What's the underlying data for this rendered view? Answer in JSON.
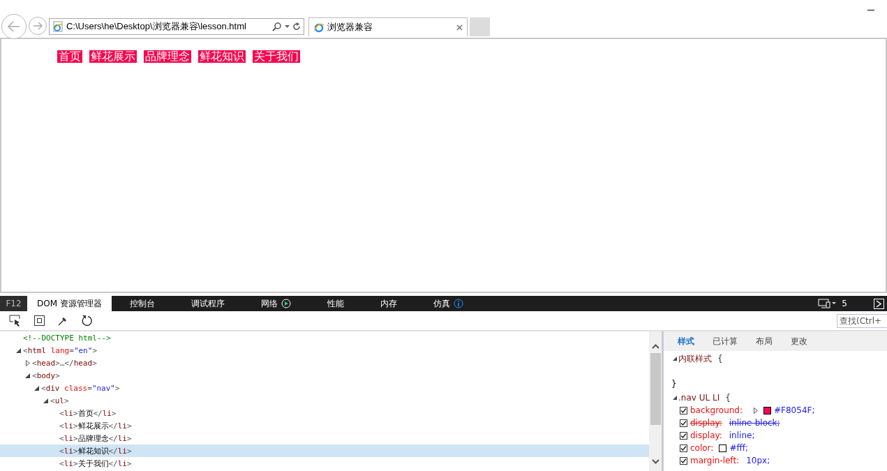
{
  "browser": {
    "address": "C:\\Users\\he\\Desktop\\浏览器兼容\\lesson.html",
    "tab_title": "浏览器兼容"
  },
  "page": {
    "nav_items": [
      "首页",
      "鲜花展示",
      "品牌理念",
      "鲜花知识",
      "关于我们"
    ]
  },
  "devtools": {
    "f12_label": "F12",
    "tabs": [
      {
        "label": "DOM 资源管理器",
        "selected": true,
        "kind": "plain"
      },
      {
        "label": "控制台",
        "selected": false,
        "kind": "plain"
      },
      {
        "label": "调试程序",
        "selected": false,
        "kind": "plain"
      },
      {
        "label": "网络",
        "selected": false,
        "kind": "play"
      },
      {
        "label": "性能",
        "selected": false,
        "kind": "plain"
      },
      {
        "label": "内存",
        "selected": false,
        "kind": "plain"
      },
      {
        "label": "仿真",
        "selected": false,
        "kind": "info"
      }
    ],
    "emulation_count": "5",
    "search": {
      "placeholder": "查找(Ctrl+"
    },
    "dom_tree": [
      {
        "tokens": [
          {
            "t": "<!--DOCTYPE html-->",
            "kind": "comment"
          }
        ],
        "selected": false
      },
      {
        "tokens": [
          {
            "t": "<",
            "kind": "punct"
          },
          {
            "t": "html",
            "kind": "tag"
          },
          {
            "t": " lang",
            "kind": "attr"
          },
          {
            "t": "=",
            "kind": "punct"
          },
          {
            "t": "\"en\"",
            "kind": "value"
          },
          {
            "t": ">",
            "kind": "punct"
          }
        ],
        "expanded": true,
        "selected": false,
        "children": [
          {
            "tokens": [
              {
                "t": "<",
                "kind": "punct"
              },
              {
                "t": "head",
                "kind": "tag"
              },
              {
                "t": ">…</",
                "kind": "punct"
              },
              {
                "t": "head",
                "kind": "tag"
              },
              {
                "t": ">",
                "kind": "punct"
              }
            ],
            "expanded": false,
            "selected": false
          },
          {
            "tokens": [
              {
                "t": "<",
                "kind": "punct"
              },
              {
                "t": "body",
                "kind": "tag"
              },
              {
                "t": ">",
                "kind": "punct"
              }
            ],
            "expanded": true,
            "selected": false,
            "children": [
              {
                "tokens": [
                  {
                    "t": "<",
                    "kind": "punct"
                  },
                  {
                    "t": "div",
                    "kind": "tag"
                  },
                  {
                    "t": " class",
                    "kind": "attr"
                  },
                  {
                    "t": "=",
                    "kind": "punct"
                  },
                  {
                    "t": "\"nav\"",
                    "kind": "value"
                  },
                  {
                    "t": ">",
                    "kind": "punct"
                  }
                ],
                "expanded": true,
                "selected": false,
                "children": [
                  {
                    "tokens": [
                      {
                        "t": "<",
                        "kind": "punct"
                      },
                      {
                        "t": "ul",
                        "kind": "tag"
                      },
                      {
                        "t": ">",
                        "kind": "punct"
                      }
                    ],
                    "expanded": true,
                    "selected": false,
                    "children": [
                      {
                        "tokens": [
                          {
                            "t": "<",
                            "kind": "punct"
                          },
                          {
                            "t": "li",
                            "kind": "tag"
                          },
                          {
                            "t": ">",
                            "kind": "punct"
                          },
                          {
                            "t": "首页",
                            "kind": "text"
                          },
                          {
                            "t": "</",
                            "kind": "punct"
                          },
                          {
                            "t": "li",
                            "kind": "tag"
                          },
                          {
                            "t": ">",
                            "kind": "punct"
                          }
                        ],
                        "selected": false
                      },
                      {
                        "tokens": [
                          {
                            "t": "<",
                            "kind": "punct"
                          },
                          {
                            "t": "li",
                            "kind": "tag"
                          },
                          {
                            "t": ">",
                            "kind": "punct"
                          },
                          {
                            "t": "鲜花展示",
                            "kind": "text"
                          },
                          {
                            "t": "</",
                            "kind": "punct"
                          },
                          {
                            "t": "li",
                            "kind": "tag"
                          },
                          {
                            "t": ">",
                            "kind": "punct"
                          }
                        ],
                        "selected": false
                      },
                      {
                        "tokens": [
                          {
                            "t": "<",
                            "kind": "punct"
                          },
                          {
                            "t": "li",
                            "kind": "tag"
                          },
                          {
                            "t": ">",
                            "kind": "punct"
                          },
                          {
                            "t": "品牌理念",
                            "kind": "text"
                          },
                          {
                            "t": "</",
                            "kind": "punct"
                          },
                          {
                            "t": "li",
                            "kind": "tag"
                          },
                          {
                            "t": ">",
                            "kind": "punct"
                          }
                        ],
                        "selected": false
                      },
                      {
                        "tokens": [
                          {
                            "t": "<",
                            "kind": "punct"
                          },
                          {
                            "t": "li",
                            "kind": "tag"
                          },
                          {
                            "t": ">",
                            "kind": "punct"
                          },
                          {
                            "t": "鲜花知识",
                            "kind": "text"
                          },
                          {
                            "t": "</",
                            "kind": "punct"
                          },
                          {
                            "t": "li",
                            "kind": "tag"
                          },
                          {
                            "t": ">",
                            "kind": "punct"
                          }
                        ],
                        "selected": true
                      },
                      {
                        "tokens": [
                          {
                            "t": "<",
                            "kind": "punct"
                          },
                          {
                            "t": "li",
                            "kind": "tag"
                          },
                          {
                            "t": ">",
                            "kind": "punct"
                          },
                          {
                            "t": "关于我们",
                            "kind": "text"
                          },
                          {
                            "t": "</",
                            "kind": "punct"
                          },
                          {
                            "t": "li",
                            "kind": "tag"
                          },
                          {
                            "t": ">",
                            "kind": "punct"
                          }
                        ],
                        "selected": false
                      }
                    ]
                  }
                ]
              }
            ]
          }
        ]
      }
    ],
    "style_tabs": [
      {
        "label": "样式",
        "selected": true
      },
      {
        "label": "已计算",
        "selected": false
      },
      {
        "label": "布局",
        "selected": false
      },
      {
        "label": "更改",
        "selected": false
      }
    ],
    "rules": [
      {
        "selector": "内联样式",
        "open": "{",
        "close": "}"
      },
      {
        "selector": ".nav UL LI",
        "open": "{",
        "properties": [
          {
            "name": "background:",
            "value": "#F8054F;",
            "checked": true,
            "overridden": false,
            "expandable": true,
            "color": "#f8054f"
          },
          {
            "name": "display:",
            "value": "inline-block;",
            "checked": true,
            "overridden": true
          },
          {
            "name": "display:",
            "value": "inline;",
            "checked": true,
            "overridden": false
          },
          {
            "name": "color:",
            "value": "#fff;",
            "checked": true,
            "overridden": false,
            "color": "#ffffff"
          },
          {
            "name": "margin-left:",
            "value": "10px;",
            "checked": true,
            "overridden": false
          }
        ]
      }
    ]
  }
}
